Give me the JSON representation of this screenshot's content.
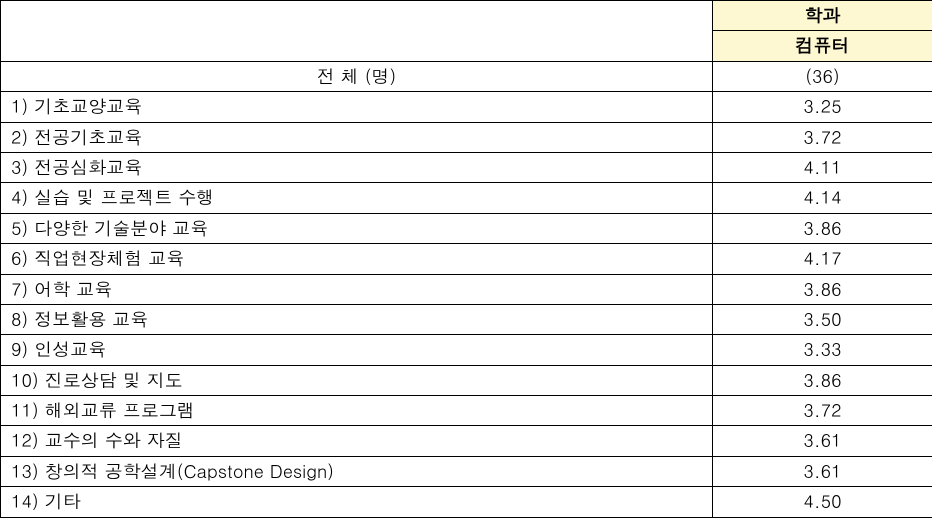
{
  "header": {
    "dept_label": "학과",
    "dept_name": "컴퓨터"
  },
  "total": {
    "label": "전 체 (명)",
    "value": "(36)"
  },
  "rows": [
    {
      "label": "1)  기초교양교육",
      "value": "3.25"
    },
    {
      "label": "2)  전공기초교육",
      "value": "3.72"
    },
    {
      "label": "3)  전공심화교육",
      "value": "4.11"
    },
    {
      "label": "4)  실습 및 프로젝트 수행",
      "value": "4.14"
    },
    {
      "label": "5)  다양한 기술분야 교육",
      "value": "3.86"
    },
    {
      "label": "6)  직업현장체험 교육",
      "value": "4.17"
    },
    {
      "label": "7)  어학 교육",
      "value": "3.86"
    },
    {
      "label": "8)  정보활용 교육",
      "value": "3.50"
    },
    {
      "label": "9)  인성교육",
      "value": "3.33"
    },
    {
      "label": "10)  진로상담 및 지도",
      "value": "3.86"
    },
    {
      "label": "11)  해외교류 프로그램",
      "value": "3.72"
    },
    {
      "label": "12)  교수의 수와 자질",
      "value": "3.61"
    },
    {
      "label": "13)  창의적 공학설계(Capstone  Design)",
      "value": "3.61"
    },
    {
      "label": "14)  기타",
      "value": "4.50"
    }
  ]
}
